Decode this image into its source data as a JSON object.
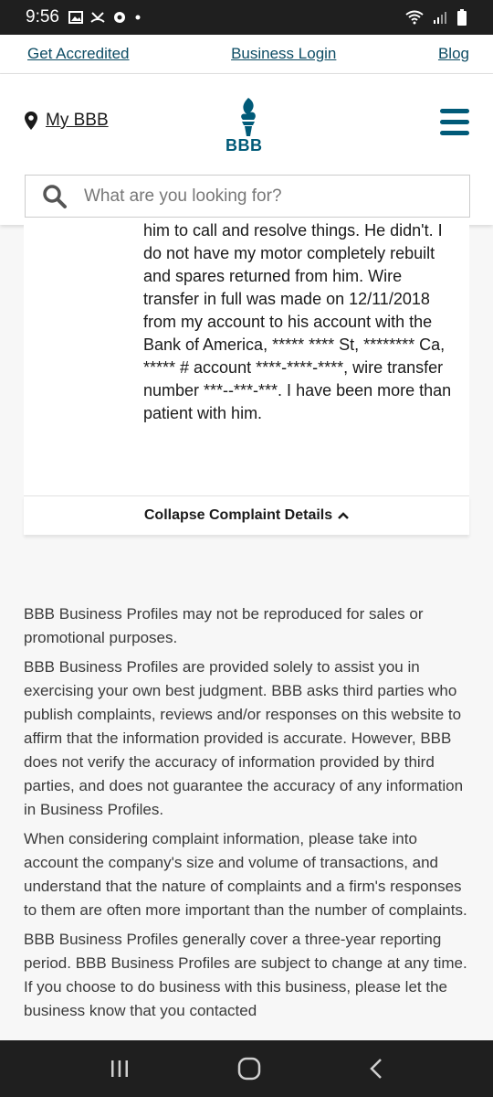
{
  "status_bar": {
    "time": "9:56",
    "left_icons": [
      "image-icon",
      "missed-call-icon",
      "settings-icon",
      "dot-icon"
    ],
    "right_icons": [
      "wifi-icon",
      "signal-icon",
      "battery-icon"
    ]
  },
  "top_nav": {
    "get_accredited": "Get Accredited",
    "business_login": "Business Login",
    "blog": "Blog"
  },
  "header": {
    "my_bbb": "My BBB",
    "logo_text": "BBB",
    "brand_color": "#005a78"
  },
  "search": {
    "placeholder": "What are you looking for?"
  },
  "complaint": {
    "text": "him to call and resolve things. He didn't. I do not have my motor completely rebuilt and spares returned from him. Wire transfer in full was made on 12/11/2018 from my account to his account with the Bank of America, ***** **** St, ******** Ca, ***** # account ****-****-****, wire transfer number ***--***-***. I have been more than patient with him.",
    "collapse_label": "Collapse Complaint Details"
  },
  "disclaimer": {
    "p1": "BBB Business Profiles may not be reproduced for sales or promotional purposes.",
    "p2": "BBB Business Profiles are provided solely to assist you in exercising your own best judgment. BBB asks third parties who publish complaints, reviews and/or responses on this website to affirm that the information provided is accurate. However, BBB does not verify the accuracy of information provided by third parties, and does not guarantee the accuracy of any information in Business Profiles.",
    "p3": "When considering complaint information, please take into account the company's size and volume of transactions, and understand that the nature of complaints and a firm's responses to them are often more important than the number of complaints.",
    "p4": "BBB Business Profiles generally cover a three-year reporting period. BBB Business Profiles are subject to change at any time. If you choose to do business with this business, please let the business know that you contacted"
  },
  "nav_bar": {
    "buttons": [
      "recents-icon",
      "home-icon",
      "back-icon"
    ]
  }
}
